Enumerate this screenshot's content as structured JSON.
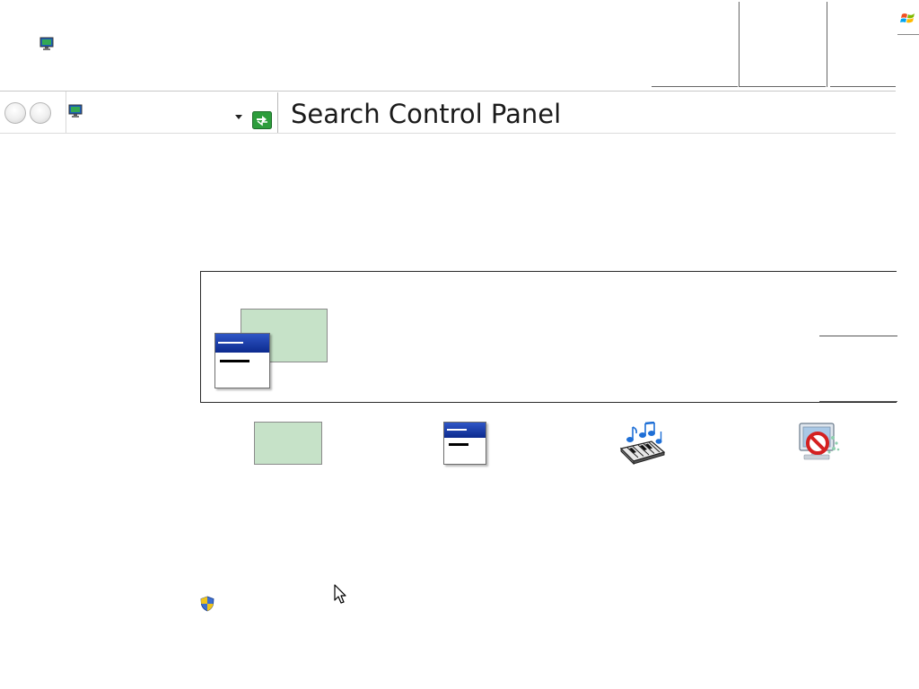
{
  "window": {
    "title_icon": "control-panel-monitor-icon",
    "os_logo": "windows-flag-icon"
  },
  "toolbar": {
    "back": "back-arrow-icon",
    "forward": "forward-arrow-icon",
    "address_icon": "control-panel-monitor-icon",
    "address_value": "",
    "dropdown": "chevron-down-icon",
    "refresh": "refresh-icon"
  },
  "search": {
    "placeholder": "Search Control Panel",
    "value": ""
  },
  "banner": {
    "icons": [
      "green-swatch-icon",
      "application-window-icon"
    ]
  },
  "tiles": [
    {
      "icon": "green-swatch-icon"
    },
    {
      "icon": "application-window-icon"
    },
    {
      "icon": "music-keyboard-icon"
    },
    {
      "icon": "blocked-display-icon"
    }
  ],
  "footer": {
    "icon": "uac-shield-icon"
  },
  "colors": {
    "swatch_green": "#c6e2c8",
    "window_titlebar_blue": "#1a3ea8",
    "border_dark": "#2a2a2a"
  }
}
